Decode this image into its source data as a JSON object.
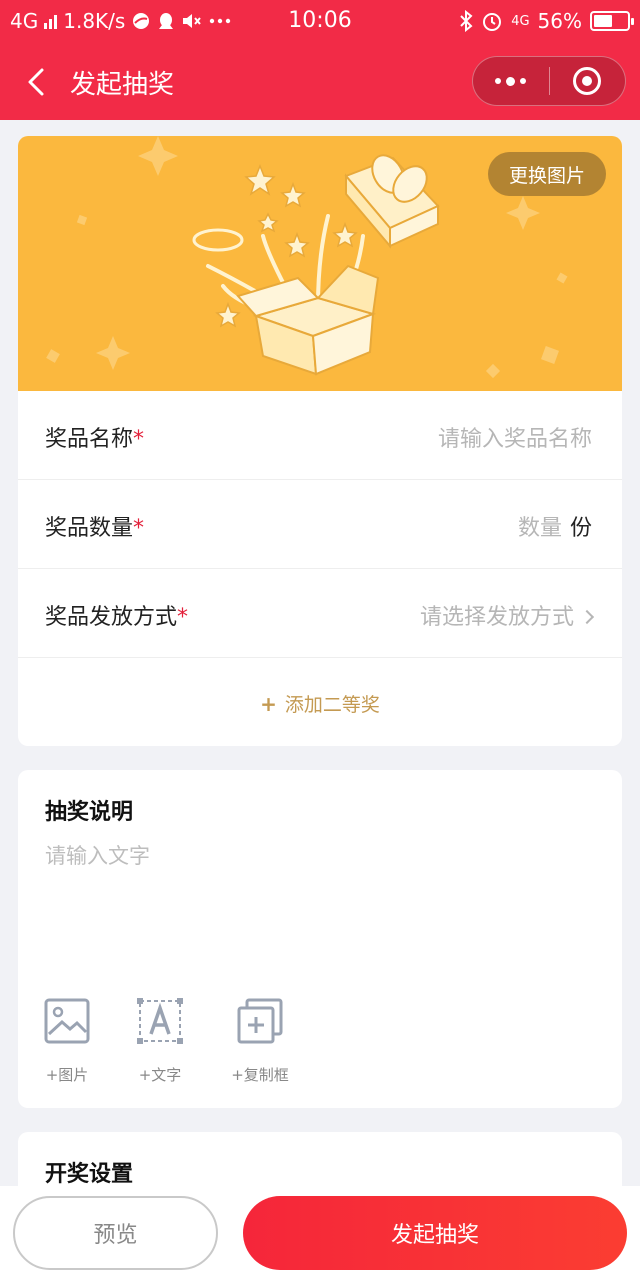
{
  "status_bar": {
    "network": "4G",
    "speed": "1.8K/s",
    "time": "10:06",
    "network2": "4G",
    "battery": "56%",
    "battery_level": 0.56
  },
  "navbar": {
    "title": "发起抽奖"
  },
  "banner": {
    "change_image_label": "更换图片",
    "background_color": "#fbb83e"
  },
  "prize": {
    "name_label": "奖品名称",
    "name_placeholder": "请输入奖品名称",
    "quantity_label": "奖品数量",
    "quantity_placeholder": "数量",
    "quantity_unit": "份",
    "method_label": "奖品发放方式",
    "method_placeholder": "请选择发放方式",
    "required_mark": "*",
    "add_second_prize": "添加二等奖"
  },
  "description": {
    "title": "抽奖说明",
    "placeholder": "请输入文字",
    "tools": [
      {
        "label": "+图片",
        "icon": "image-icon"
      },
      {
        "label": "+文字",
        "icon": "text-icon"
      },
      {
        "label": "+复制框",
        "icon": "copy-box-icon"
      }
    ]
  },
  "draw_settings": {
    "title": "开奖设置"
  },
  "bottom": {
    "preview_label": "预览",
    "start_label": "发起抽奖"
  },
  "colors": {
    "brand_red": "#f22b47",
    "gold": "#c49a52"
  }
}
